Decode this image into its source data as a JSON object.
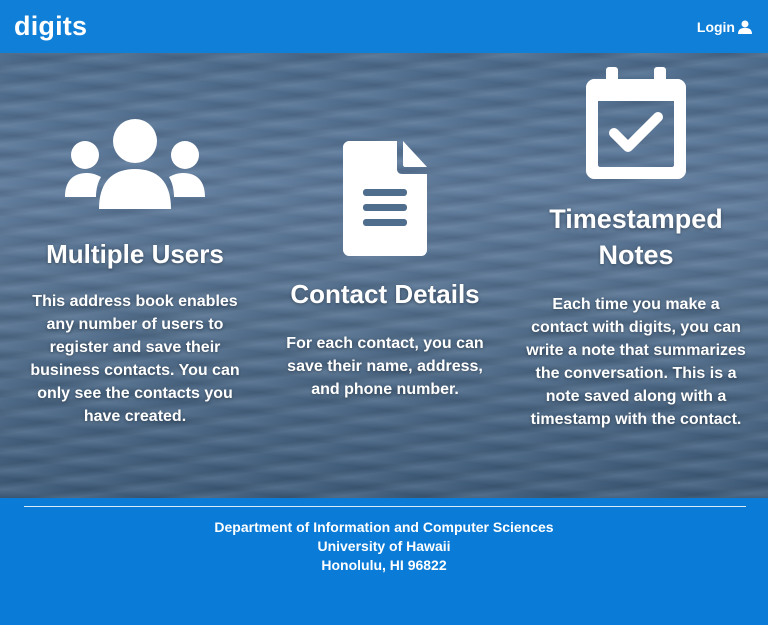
{
  "navbar": {
    "brand": "digits",
    "login_label": "Login",
    "login_icon": "user-icon"
  },
  "features": [
    {
      "icon": "users-icon",
      "title": "Multiple Users",
      "text": "This address book enables any number of users to register and save their business contacts. You can only see the contacts you have created."
    },
    {
      "icon": "file-icon",
      "title": "Contact Details",
      "text": "For each contact, you can save their name, address, and phone number."
    },
    {
      "icon": "calendar-check-icon",
      "title": "Timestamped Notes",
      "text": "Each time you make a contact with digits, you can write a note that summarizes the conversation. This is a note saved along with a timestamp with the contact."
    }
  ],
  "footer": {
    "lines": [
      "Department of Information and Computer Sciences",
      "University of Hawaii",
      "Honolulu, HI 96822"
    ]
  },
  "colors": {
    "primary": "#0f7fd8",
    "text": "#ffffff"
  }
}
